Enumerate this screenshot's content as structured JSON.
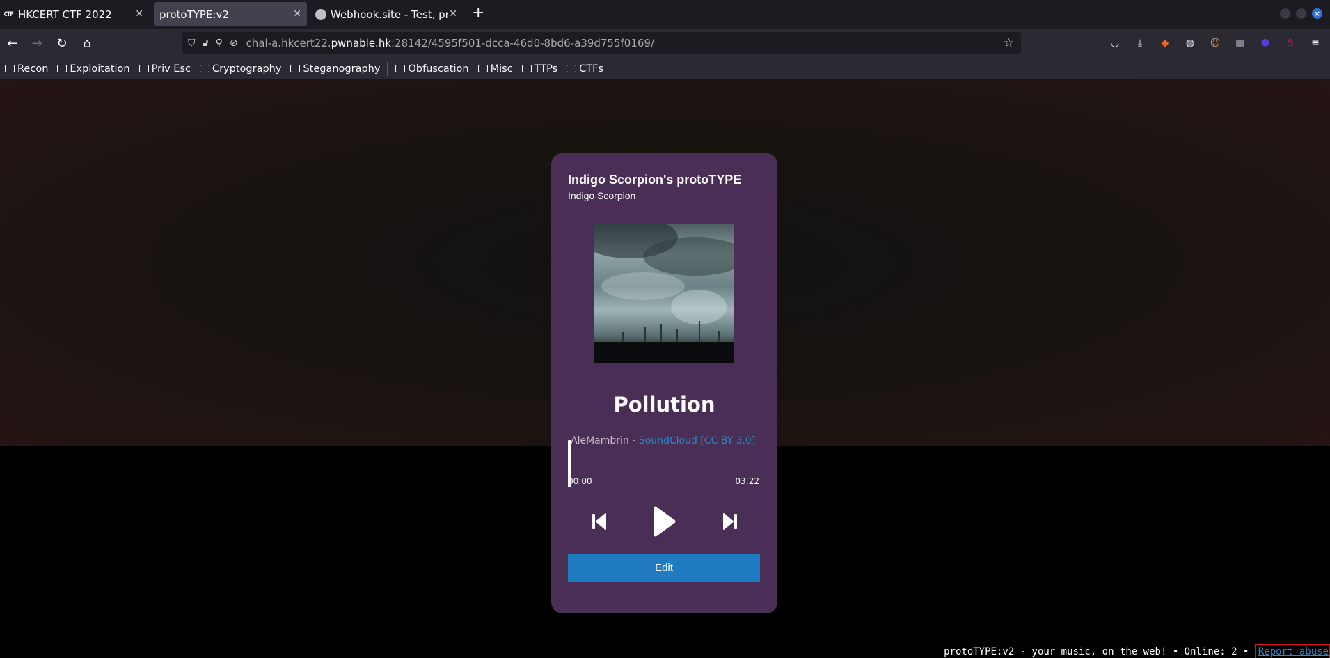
{
  "browser": {
    "tabs": [
      {
        "title": "HKCERT CTF 2022",
        "favicon": "CTF",
        "active": false
      },
      {
        "title": "protoTYPE:v2",
        "favicon": "",
        "active": true
      },
      {
        "title": "Webhook.site - Test, proc",
        "favicon": "webhook-icon",
        "active": false
      }
    ],
    "new_tab": "+",
    "url": {
      "prefix": "chal-a.hkcert22.",
      "host": "pwnable.hk",
      "suffix": ":28142/4595f501-dcca-46d0-8bd6-a39d755f0169/"
    },
    "bookmarks": [
      "Recon",
      "Exploitation",
      "Priv Esc",
      "Cryptography",
      "Steganography",
      "Obfuscation",
      "Misc",
      "TTPs",
      "CTFs"
    ]
  },
  "player": {
    "playlist_title": "Indigo Scorpion's protoTYPE",
    "artist": "Indigo Scorpion",
    "song_title": "Pollution",
    "credit_author": "AleMambrin -",
    "credit_link": "SoundCloud [CC BY 3.0]",
    "time_current": "00:00",
    "time_total": "03:22",
    "progress_fraction": 0,
    "edit_label": "Edit"
  },
  "footer": {
    "text": "protoTYPE:v2 - your music, on the web! • Online: 2 •",
    "report_label": "Report abuse"
  },
  "colors": {
    "card_bg": "#4a2e55",
    "accent": "#1f7ac0",
    "link": "#2e86c9"
  }
}
